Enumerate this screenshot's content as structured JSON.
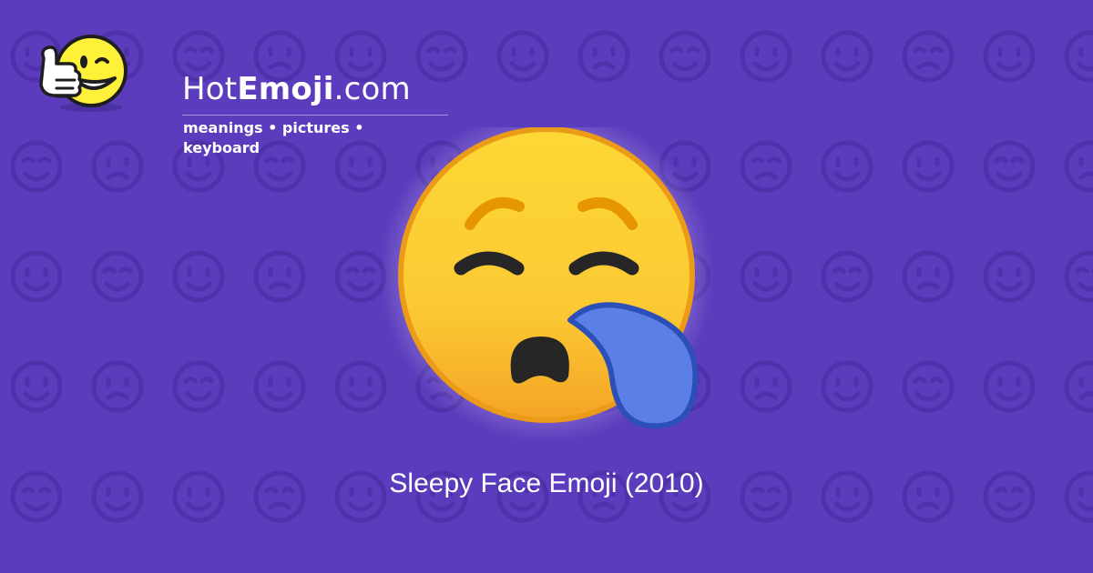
{
  "site": {
    "name_prefix": "Hot",
    "name_bold": "Emoji",
    "name_suffix": ".com",
    "tagline": "meanings • pictures • keyboard"
  },
  "emoji": {
    "caption": "Sleepy Face Emoji (2010)",
    "icon": "sleepy-face"
  },
  "background": {
    "color": "#5b3cbd",
    "pattern_color": "#4f32ab",
    "pattern_icons": [
      "smile",
      "relieved",
      "wink",
      "hearts",
      "tired",
      "ok-hand",
      "neutral",
      "eyes",
      "smirk",
      "recycle",
      "raised-hands",
      "music-notes",
      "zzz",
      "frown",
      "grin",
      "sparkles",
      "striped-heart",
      "broken-heart",
      "confused",
      "stuck-out-tongue",
      "persevere",
      "heart-arrow",
      "heart-decoration",
      "heart",
      "monkey",
      "scream",
      "devil",
      "angry",
      "arrow-left",
      "fire",
      "confetti",
      "rose",
      "sun",
      "flexed-bicep",
      "check-mark",
      "kiss",
      "cat",
      "waving-hand",
      "mask",
      "camera",
      "beaming-heart",
      "kissing-face"
    ]
  },
  "colors": {
    "face_top": "#fdd835",
    "face_bottom": "#f4a426",
    "face_outline": "#eb9b17",
    "brow": "#e59600",
    "feature": "#262626",
    "snot_bubble": "#5a7fe6",
    "snot_outline": "#2d4fb8",
    "text": "#ffffff"
  }
}
